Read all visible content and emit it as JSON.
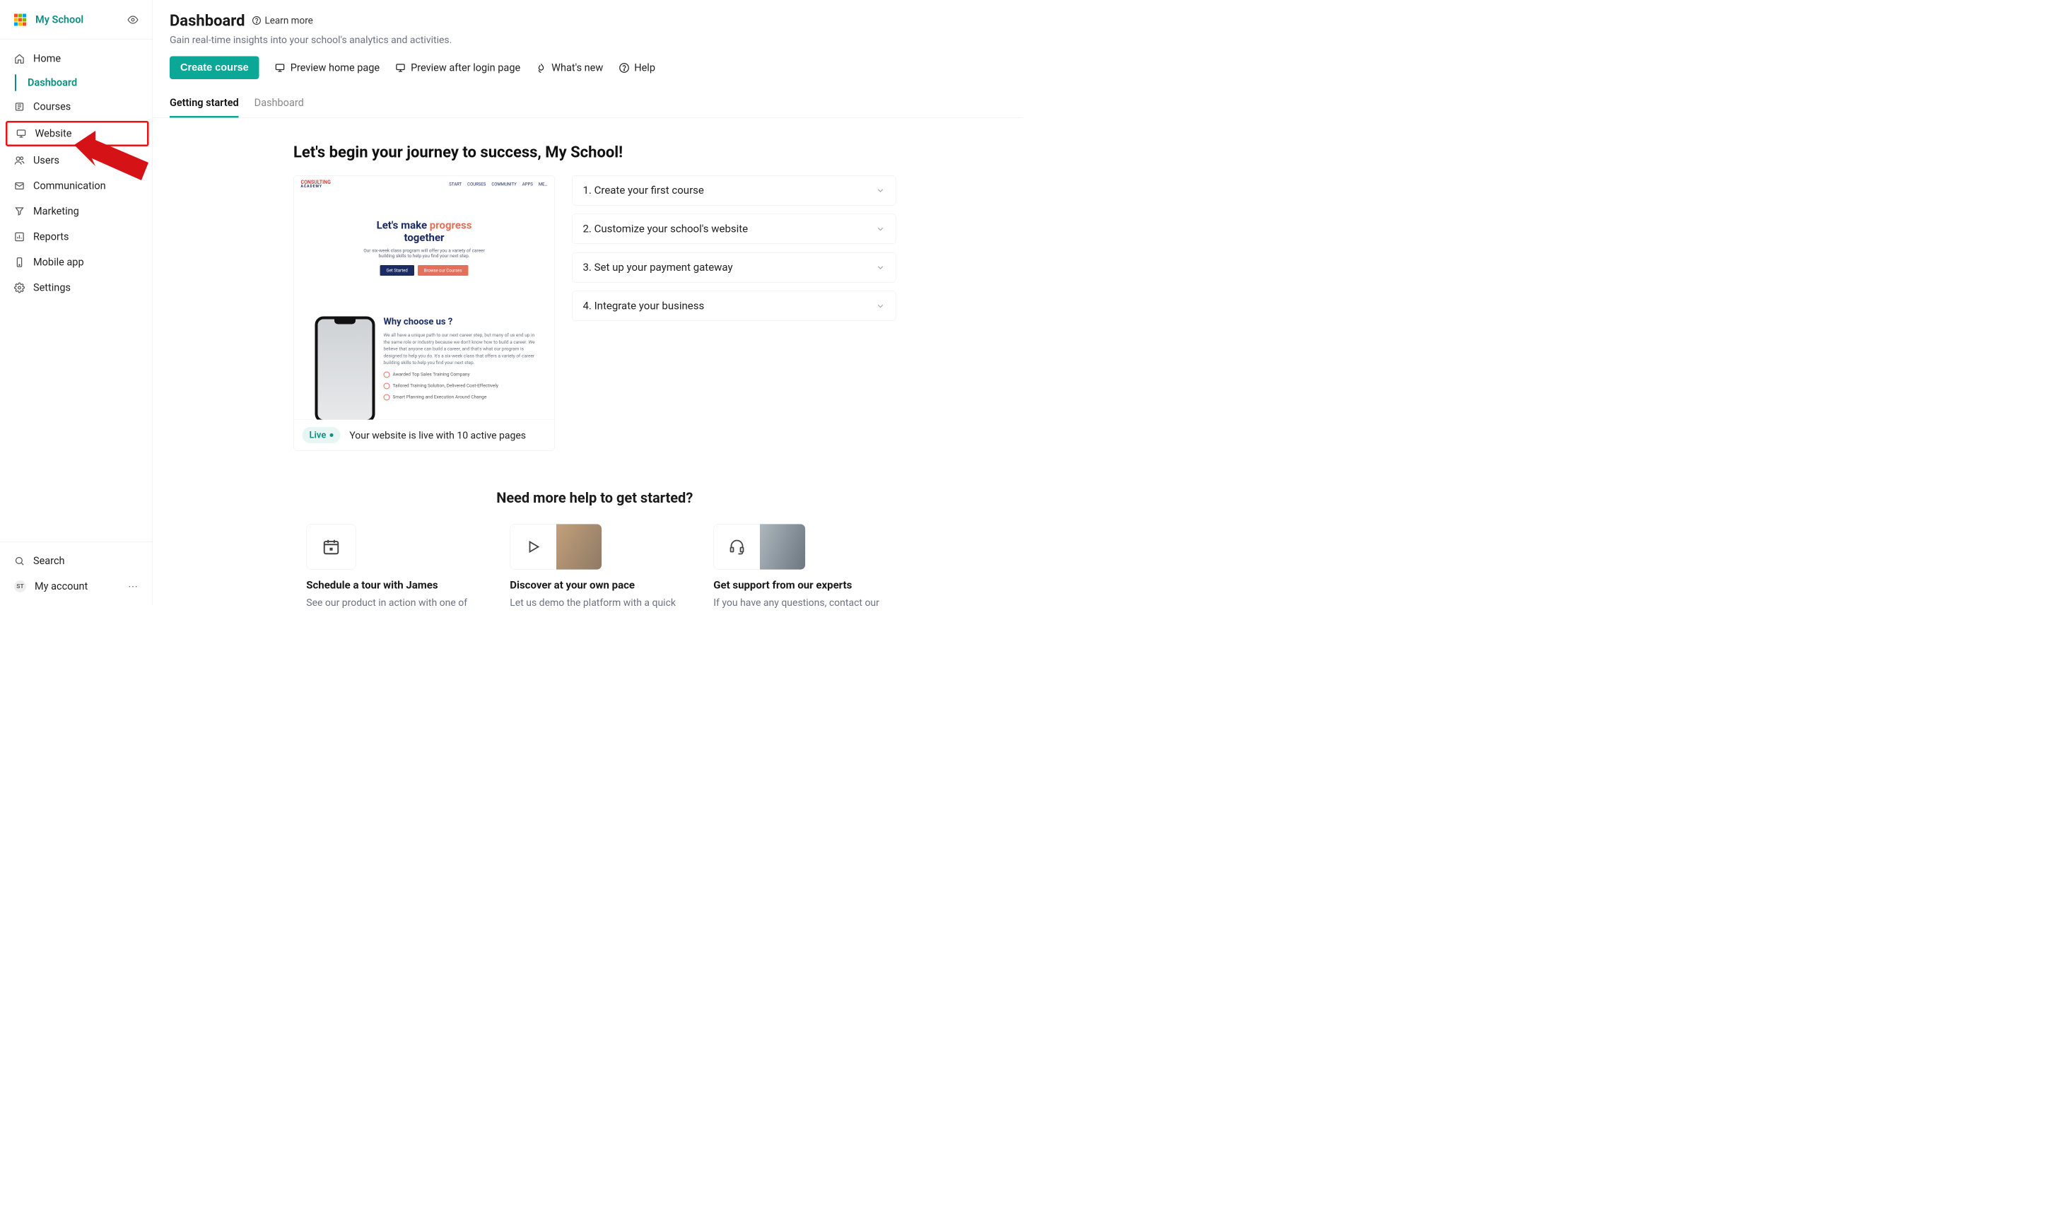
{
  "brand": {
    "name": "My School"
  },
  "sidebar": {
    "header_visibility_icon": "eye-icon",
    "items": [
      {
        "label": "Home",
        "key": "home"
      },
      {
        "label": "Dashboard",
        "key": "dashboard",
        "sub": true,
        "active": true
      },
      {
        "label": "Courses",
        "key": "courses"
      },
      {
        "label": "Website",
        "key": "website",
        "highlighted": true
      },
      {
        "label": "Users",
        "key": "users"
      },
      {
        "label": "Communication",
        "key": "communication"
      },
      {
        "label": "Marketing",
        "key": "marketing"
      },
      {
        "label": "Reports",
        "key": "reports"
      },
      {
        "label": "Mobile app",
        "key": "mobile-app"
      },
      {
        "label": "Settings",
        "key": "settings"
      }
    ],
    "search_label": "Search",
    "account_label": "My account",
    "account_initials": "ST"
  },
  "header": {
    "title": "Dashboard",
    "learn_more": "Learn more",
    "subtitle": "Gain real-time insights into your school's analytics and activities.",
    "create_course": "Create course",
    "preview_home": "Preview home page",
    "preview_after_login": "Preview after login page",
    "whats_new": "What's new",
    "help": "Help"
  },
  "tabs": {
    "active": 0,
    "items": [
      {
        "label": "Getting started"
      },
      {
        "label": "Dashboard"
      }
    ]
  },
  "onboarding": {
    "heading": "Let's begin your journey to success, My School!",
    "preview": {
      "logo_line1": "CONSULTING",
      "logo_line2": "ACADEMY",
      "nav": [
        "START",
        "COURSES",
        "COMMUNITY",
        "APPS",
        "ME…"
      ],
      "hero_line1": "Let's make ",
      "hero_accent": "progress",
      "hero_line2": "together",
      "hero_desc": "Our six-week class program will offer you a variety of career building skills to help you find your next step.",
      "hero_btn1": "Get Started",
      "hero_btn2": "Browse our Courses",
      "choose_title": "Why choose us ?",
      "choose_text": "We all have a unique path to our next career step, but many of us end up in the same role or industry because we don't know how to build a career. We believe that anyone can build a career, and that's what our program is designed to help you do. It's a six-week class that offers a variety of career building skills to help you find your next step.",
      "bullets": [
        "Awarded Top Sales Training Company",
        "Tailored Training Solution, Delivered Cost-Effectively",
        "Smart Planning and Execution Around Change"
      ]
    },
    "live_label": "Live",
    "live_status": "Your website is live with 10 active pages",
    "steps": [
      {
        "label": "1. Create your first course"
      },
      {
        "label": "2. Customize your school's website"
      },
      {
        "label": "3. Set up your payment gateway"
      },
      {
        "label": "4. Integrate your business"
      }
    ]
  },
  "help": {
    "heading": "Need more help to get started?",
    "cards": [
      {
        "title": "Schedule a tour with James",
        "desc": "See our product in action with one of"
      },
      {
        "title": "Discover at your own pace",
        "desc": "Let us demo the platform with a quick"
      },
      {
        "title": "Get support from our experts",
        "desc": "If you have any questions, contact our"
      }
    ]
  }
}
